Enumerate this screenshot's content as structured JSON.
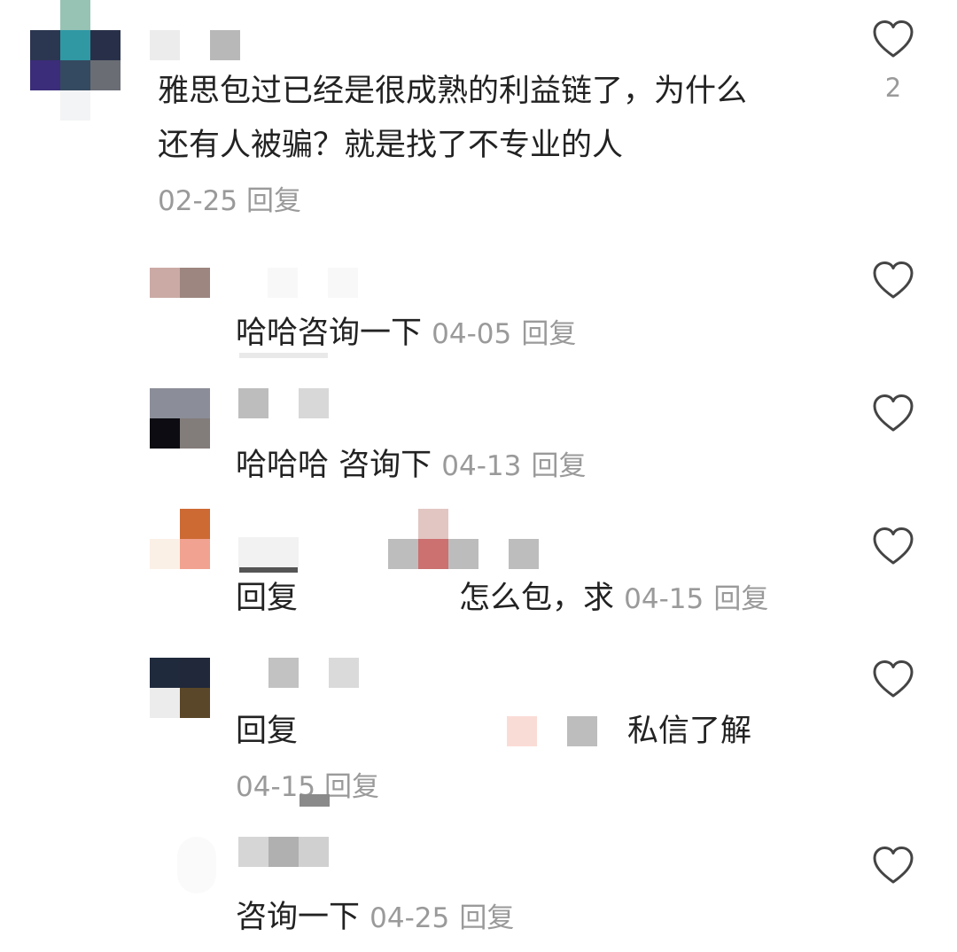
{
  "comments": [
    {
      "text_line1": "雅思包过已经是很成熟的利益链了，为什么",
      "text_line2": "还有人被骗？就是找了不专业的人",
      "date": "02-25",
      "reply_label": "回复",
      "like_count": "2",
      "icon": "heart-outline-icon"
    }
  ],
  "replies": [
    {
      "text": "哈哈咨询一下",
      "date": "04-05",
      "reply_label": "回复",
      "icon": "heart-outline-icon"
    },
    {
      "text": "哈哈哈 咨询下",
      "date": "04-13",
      "reply_label": "回复",
      "icon": "heart-outline-icon"
    },
    {
      "prefix": "回复",
      "text": "怎么包，求",
      "date": "04-15",
      "reply_label": "回复",
      "icon": "heart-outline-icon"
    },
    {
      "prefix": "回复",
      "text": "私信了解",
      "date": "04-15",
      "reply_label": "回复",
      "icon": "heart-outline-icon"
    },
    {
      "text": "咨询一下",
      "date": "04-25",
      "reply_label": "回复",
      "icon": "heart-outline-icon"
    }
  ],
  "colors": {
    "meta_gray": "#9a9a9a",
    "text": "#222222",
    "heart_stroke": "#444444"
  }
}
